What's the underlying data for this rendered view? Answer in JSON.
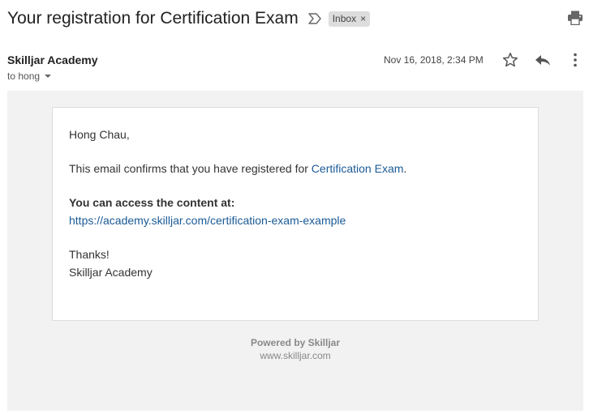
{
  "header": {
    "subject": "Your registration for Certification Exam",
    "label_chip": "Inbox",
    "label_chip_remove": "×"
  },
  "message": {
    "sender": "Skilljar Academy",
    "recipient": "to hong",
    "date": "Nov 16, 2018, 2:34 PM"
  },
  "body": {
    "greeting": "Hong Chau,",
    "confirm_prefix": "This email confirms that you have registered for ",
    "confirm_link": "Certification Exam",
    "confirm_suffix": ".",
    "access_heading": "You can access the content at:",
    "access_url": "https://academy.skilljar.com/certification-exam-example",
    "thanks": "Thanks!",
    "signature": "Skilljar Academy"
  },
  "footer": {
    "powered_by": "Powered by Skilljar",
    "url": "www.skilljar.com"
  },
  "icons": {
    "label": "label-arrow-icon",
    "print": "print-icon",
    "star": "star-icon",
    "reply": "reply-icon",
    "more": "more-vert-icon",
    "dropdown": "chevron-down-icon"
  },
  "colors": {
    "link": "#1a5a96",
    "chip_bg": "#dddddd",
    "body_bg": "#f2f2f2"
  }
}
